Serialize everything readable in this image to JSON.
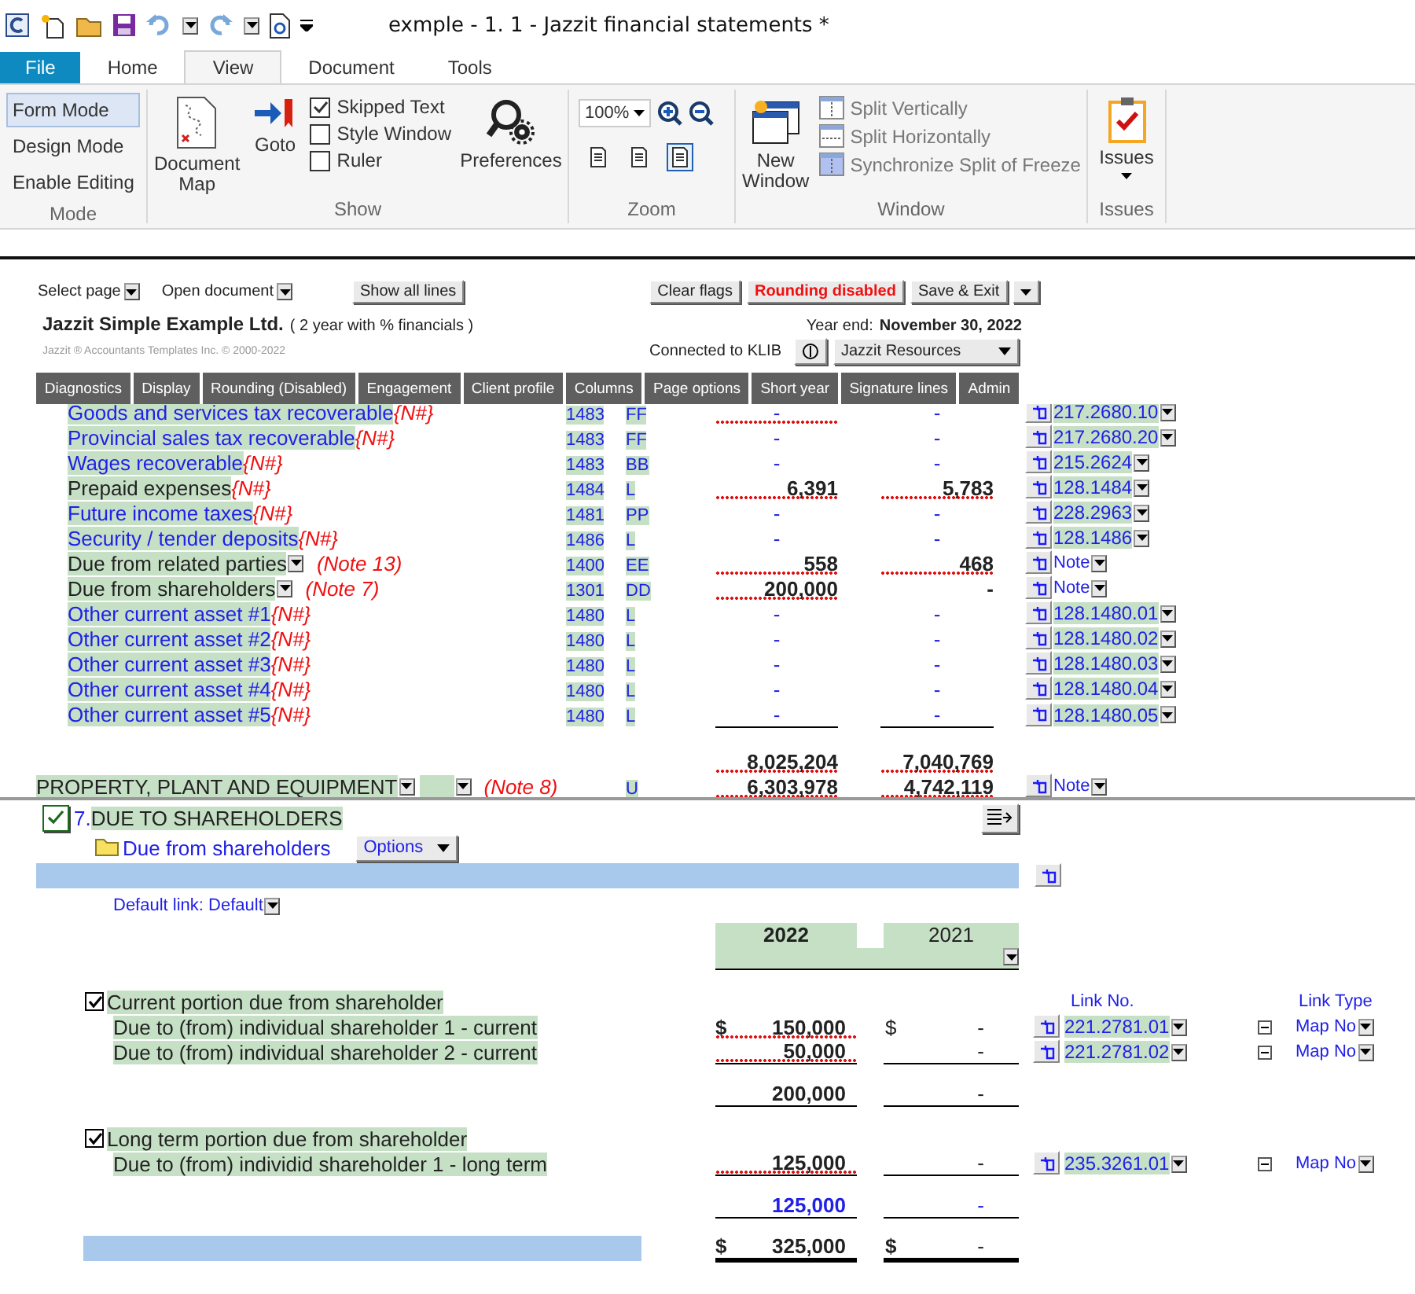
{
  "title_bar": {
    "title": "exmple - 1. 1 - Jazzit financial statements *"
  },
  "ribbon_tabs": [
    {
      "label": "File",
      "kind": "file",
      "selected": false
    },
    {
      "label": "Home",
      "kind": "tab",
      "selected": false
    },
    {
      "label": "View",
      "kind": "tab",
      "selected": true
    },
    {
      "label": "Document",
      "kind": "tab",
      "selected": false
    },
    {
      "label": "Tools",
      "kind": "tab",
      "selected": false
    }
  ],
  "ribbon": {
    "mode": {
      "label": "Mode",
      "items": [
        {
          "label": "Form Mode",
          "selected": true
        },
        {
          "label": "Design Mode",
          "selected": false
        },
        {
          "label": "Enable Editing",
          "selected": false
        }
      ]
    },
    "show": {
      "label": "Show",
      "document_map": "Document Map",
      "goto": "Goto",
      "checkboxes": [
        {
          "label": "Skipped Text",
          "checked": true
        },
        {
          "label": "Style Window",
          "checked": false
        },
        {
          "label": "Ruler",
          "checked": false
        }
      ],
      "preferences": "Preferences"
    },
    "zoom": {
      "label": "Zoom",
      "value": "100%",
      "fit_buttons": [
        {
          "selected": false
        },
        {
          "selected": false
        },
        {
          "selected": true
        }
      ]
    },
    "window": {
      "label": "Window",
      "new_window": "New Window",
      "items": [
        {
          "label": "Split Vertically",
          "disabled": true
        },
        {
          "label": "Split Horizontally",
          "disabled": true
        },
        {
          "label": "Synchronize Split of Freeze",
          "disabled": true
        }
      ]
    },
    "issues": {
      "label": "Issues",
      "button": "Issues"
    }
  },
  "doc_toolbar": {
    "select_page": "Select page",
    "open_document": "Open document",
    "show_all_lines": "Show all lines",
    "clear_flags": "Clear flags",
    "rounding": "Rounding disabled",
    "save_exit": "Save & Exit"
  },
  "header": {
    "company": "Jazzit Simple Example Ltd.",
    "subtitle": "( 2 year with % financials )",
    "year_end_label": "Year end:",
    "year_end": "November 30, 2022",
    "copyright": "Jazzit ® Accountants Templates Inc. © 2000-2022",
    "connection": "Connected to KLIB",
    "resources": "Jazzit Resources"
  },
  "menu_tabs": [
    "Diagnostics",
    "Display",
    "Rounding (Disabled)",
    "Engagement",
    "Client profile",
    "Columns",
    "Page options",
    "Short year",
    "Signature lines",
    "Admin"
  ],
  "rows": [
    {
      "kind": "item",
      "label": "Goods and services tax recoverable",
      "zero_balance": true,
      "flag": "{N#}",
      "code": "1483",
      "letter": "FF",
      "amounts": [
        {
          "text": "-",
          "flagged": true
        },
        {
          "text": "-",
          "flagged": false
        }
      ],
      "link": "217.2680.10",
      "mapped": true
    },
    {
      "kind": "item",
      "label": "Provincial sales tax recoverable",
      "zero_balance": true,
      "flag": "{N#}",
      "code": "1483",
      "letter": "FF",
      "amounts": [
        {
          "text": "-",
          "flagged": false
        },
        {
          "text": "-",
          "flagged": false
        }
      ],
      "link": "217.2680.20",
      "mapped": true
    },
    {
      "kind": "item",
      "label": "Wages recoverable",
      "zero_balance": true,
      "flag": "{N#}",
      "code": "1483",
      "letter": "BB",
      "amounts": [
        {
          "text": "-",
          "flagged": false
        },
        {
          "text": "-",
          "flagged": false
        }
      ],
      "link": "215.2624",
      "mapped": true
    },
    {
      "kind": "item",
      "label": "Prepaid expenses",
      "zero_balance": false,
      "flag": "{N#}",
      "code": "1484",
      "letter": "L",
      "amounts": [
        {
          "text": "6,391",
          "flagged": true
        },
        {
          "text": "5,783",
          "flagged": true
        }
      ],
      "link": "128.1484",
      "mapped": true
    },
    {
      "kind": "item",
      "label": "Future income taxes",
      "zero_balance": true,
      "flag": "{N#}",
      "code": "1481",
      "letter": "PP",
      "amounts": [
        {
          "text": "-",
          "flagged": false
        },
        {
          "text": "-",
          "flagged": false
        }
      ],
      "link": "228.2963",
      "mapped": true
    },
    {
      "kind": "item",
      "label": "Security / tender deposits",
      "zero_balance": true,
      "flag": "{N#}",
      "code": "1486",
      "letter": "L",
      "amounts": [
        {
          "text": "-",
          "flagged": false
        },
        {
          "text": "-",
          "flagged": false
        }
      ],
      "link": "128.1486",
      "mapped": true
    },
    {
      "kind": "item",
      "label": "Due from related parties",
      "zero_balance": false,
      "note": "(Note 13)",
      "code": "1400",
      "letter": "EE",
      "amounts": [
        {
          "text": "558",
          "flagged": true
        },
        {
          "text": "468",
          "flagged": true
        }
      ],
      "link": "Note",
      "mapped": false
    },
    {
      "kind": "item",
      "label": "Due from shareholders",
      "zero_balance": false,
      "note": "(Note 7)",
      "code": "1301",
      "letter": "DD",
      "amounts": [
        {
          "text": "200,000",
          "flagged": true
        },
        {
          "text": "-",
          "flagged": false
        }
      ],
      "link": "Note",
      "mapped": false
    },
    {
      "kind": "item",
      "label": "Other current asset #1",
      "zero_balance": true,
      "flag": "{N#}",
      "code": "1480",
      "letter": "L",
      "amounts": [
        {
          "text": "-",
          "flagged": false
        },
        {
          "text": "-",
          "flagged": false
        }
      ],
      "link": "128.1480.01",
      "mapped": true
    },
    {
      "kind": "item",
      "label": "Other current asset #2",
      "zero_balance": true,
      "flag": "{N#}",
      "code": "1480",
      "letter": "L",
      "amounts": [
        {
          "text": "-",
          "flagged": false
        },
        {
          "text": "-",
          "flagged": false
        }
      ],
      "link": "128.1480.02",
      "mapped": true
    },
    {
      "kind": "item",
      "label": "Other current asset #3",
      "zero_balance": true,
      "flag": "{N#}",
      "code": "1480",
      "letter": "L",
      "amounts": [
        {
          "text": "-",
          "flagged": false
        },
        {
          "text": "-",
          "flagged": false
        }
      ],
      "link": "128.1480.03",
      "mapped": true
    },
    {
      "kind": "item",
      "label": "Other current asset #4",
      "zero_balance": true,
      "flag": "{N#}",
      "code": "1480",
      "letter": "L",
      "amounts": [
        {
          "text": "-",
          "flagged": false
        },
        {
          "text": "-",
          "flagged": false
        }
      ],
      "link": "128.1480.04",
      "mapped": true
    },
    {
      "kind": "item",
      "label": "Other current asset #5",
      "zero_balance": true,
      "flag": "{N#}",
      "code": "1480",
      "letter": "L",
      "amounts": [
        {
          "text": "-",
          "flagged": false
        },
        {
          "text": "-",
          "flagged": false
        }
      ],
      "link": "128.1480.05",
      "mapped": true
    },
    {
      "kind": "total",
      "amounts": [
        {
          "text": "8,025,204",
          "flagged": true
        },
        {
          "text": "7,040,769",
          "flagged": true
        }
      ]
    },
    {
      "kind": "heading",
      "label": "PROPERTY, PLANT AND EQUIPMENT",
      "zero_balance": false,
      "note": "(Note 8)",
      "letter": "U",
      "amounts": [
        {
          "text": "6,303,978",
          "flagged": true
        },
        {
          "text": "4,742,119",
          "flagged": true
        }
      ],
      "link": "Note",
      "mapped": false
    }
  ],
  "note_section": {
    "checked": true,
    "number": "7.",
    "title": "DUE TO SHAREHOLDERS",
    "subtitle": "Due from shareholders",
    "options": "Options",
    "default_link": "Default link: Default",
    "years": [
      {
        "label": "2022",
        "current": true
      },
      {
        "label": "2021",
        "current": false
      }
    ],
    "link_no_header": "Link No.",
    "link_type_header": "Link Type",
    "groups": [
      {
        "checked": true,
        "title": "Current portion due from shareholder",
        "lines": [
          {
            "label": "Due to (from) individual shareholder 1 - current",
            "amounts": [
              {
                "symbol": "$",
                "text": "150,000",
                "flagged": true
              },
              {
                "symbol": "$",
                "text": "-",
                "flagged": false
              }
            ],
            "link": "221.2781.01",
            "link_type": "Map No"
          },
          {
            "label": "Due to (from) individual shareholder 2 - current",
            "amounts": [
              {
                "text": "50,000",
                "flagged": true
              },
              {
                "text": "-",
                "flagged": false
              }
            ],
            "link": "221.2781.02",
            "link_type": "Map No"
          }
        ],
        "total": {
          "emphasis": false,
          "amounts": [
            {
              "text": "200,000"
            },
            {
              "text": "-"
            }
          ]
        }
      },
      {
        "checked": true,
        "title": "Long term portion due from shareholder",
        "lines": [
          {
            "label": "Due to (from) individid shareholder 1 - long term",
            "amounts": [
              {
                "text": "125,000",
                "flagged": true
              },
              {
                "text": "-",
                "flagged": false
              }
            ],
            "link": "235.3261.01",
            "link_type": "Map No"
          }
        ],
        "total": {
          "emphasis": true,
          "amounts": [
            {
              "text": "125,000"
            },
            {
              "text": "-"
            }
          ]
        }
      }
    ],
    "grand_total": {
      "amounts": [
        {
          "symbol": "$",
          "text": "325,000"
        },
        {
          "symbol": "$",
          "text": "-"
        }
      ]
    }
  }
}
